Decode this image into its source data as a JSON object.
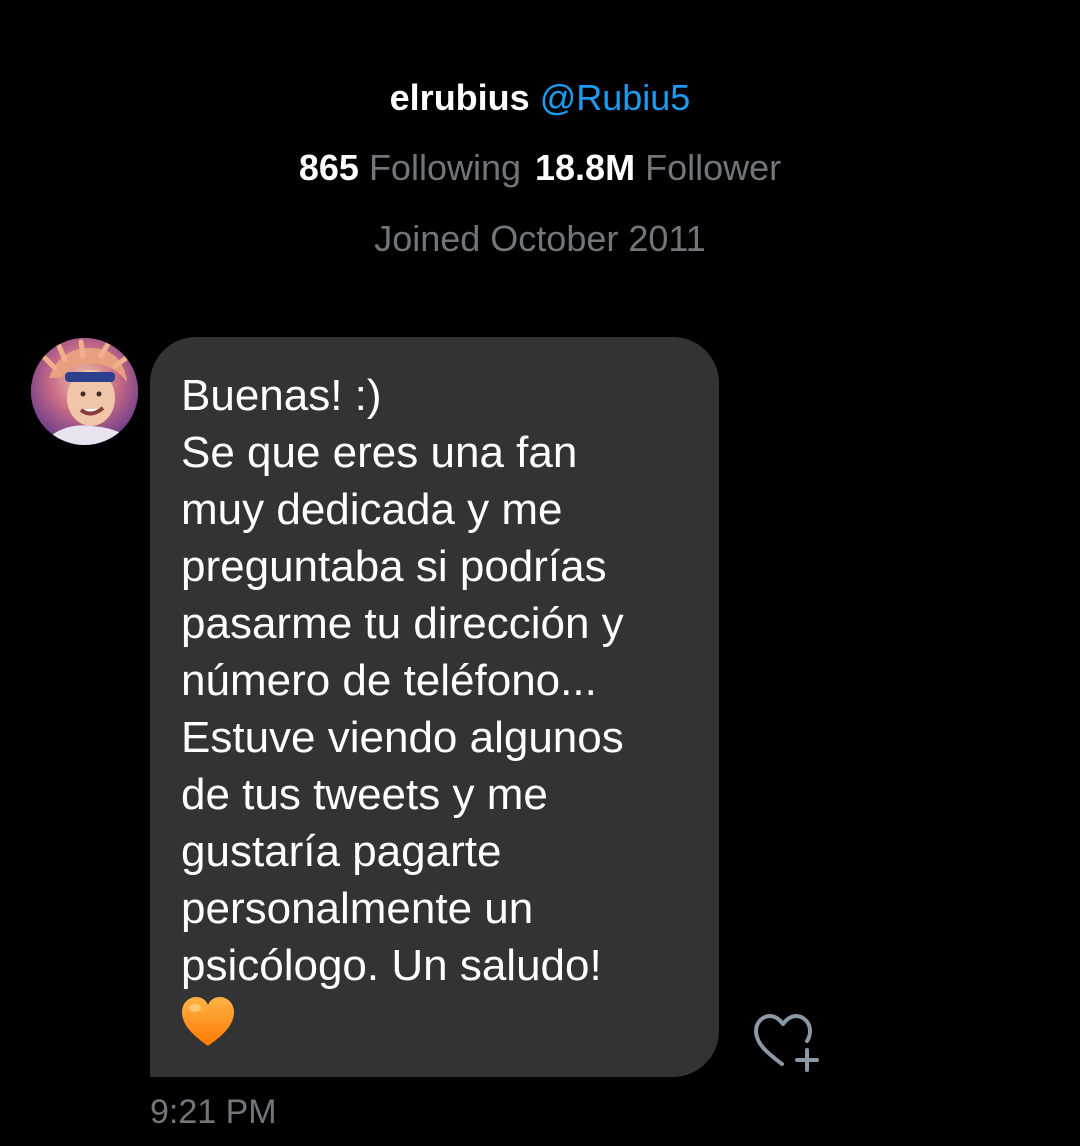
{
  "profile": {
    "display_name": "elrubius",
    "handle": "@Rubiu5",
    "following_count": "865",
    "following_label": "Following",
    "followers_count": "18.8M",
    "followers_label": "Follower",
    "joined": "Joined October 2011"
  },
  "message": {
    "text": "Buenas! :)\nSe que eres una fan\nmuy dedicada y me\npreguntaba si podrías\npasarme tu dirección y\nnúmero de teléfono...\nEstuve viendo algunos\nde tus tweets y me\ngustaría pagarte\npersonalmente un\npsicólogo. Un saludo!",
    "emoji": "orange-heart",
    "timestamp": "9:21 PM"
  },
  "icons": {
    "avatar": "sender-avatar",
    "react": "add-reaction-heart-icon"
  },
  "colors": {
    "background": "#000000",
    "bubble": "#333333",
    "accent": "#1d9bf0",
    "secondary_text": "#71767b",
    "emoji_heart": "#ff8c1a"
  }
}
